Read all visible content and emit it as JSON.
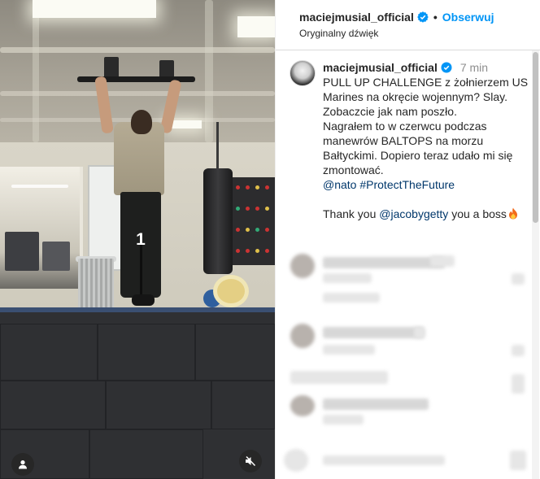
{
  "post": {
    "username": "maciejmusial_official",
    "separator": "•",
    "follow_label": "Obserwuj",
    "audio_label": "Oryginalny dźwięk"
  },
  "caption": {
    "username": "maciejmusial_official",
    "time": "7 min",
    "line1": "PULL UP CHALLENGE z żołnierzem US Marines na okręcie wojennym? Slay. Zobaczcie jak nam poszło.",
    "line2": "Nagrałem to w czerwcu podczas manewrów BALTOPS na morzu Bałtyckimi. Dopiero teraz udało mi się zmontować.",
    "mention_nato": "@nato",
    "hashtag": "#ProtectTheFuture",
    "thanks_prefix": "Thank you ",
    "mention_jacob": "@jacobygetty",
    "thanks_suffix": " you a boss"
  },
  "video": {
    "overlay_number": "1"
  },
  "icons": {
    "verified": "verified-badge-icon",
    "fire": "fire-emoji-icon",
    "tagged_user": "person-icon",
    "mute": "muted-speaker-icon"
  },
  "colors": {
    "accent": "#0095f6",
    "link": "#00376b",
    "text": "#262626",
    "muted": "#8e8e8e"
  }
}
